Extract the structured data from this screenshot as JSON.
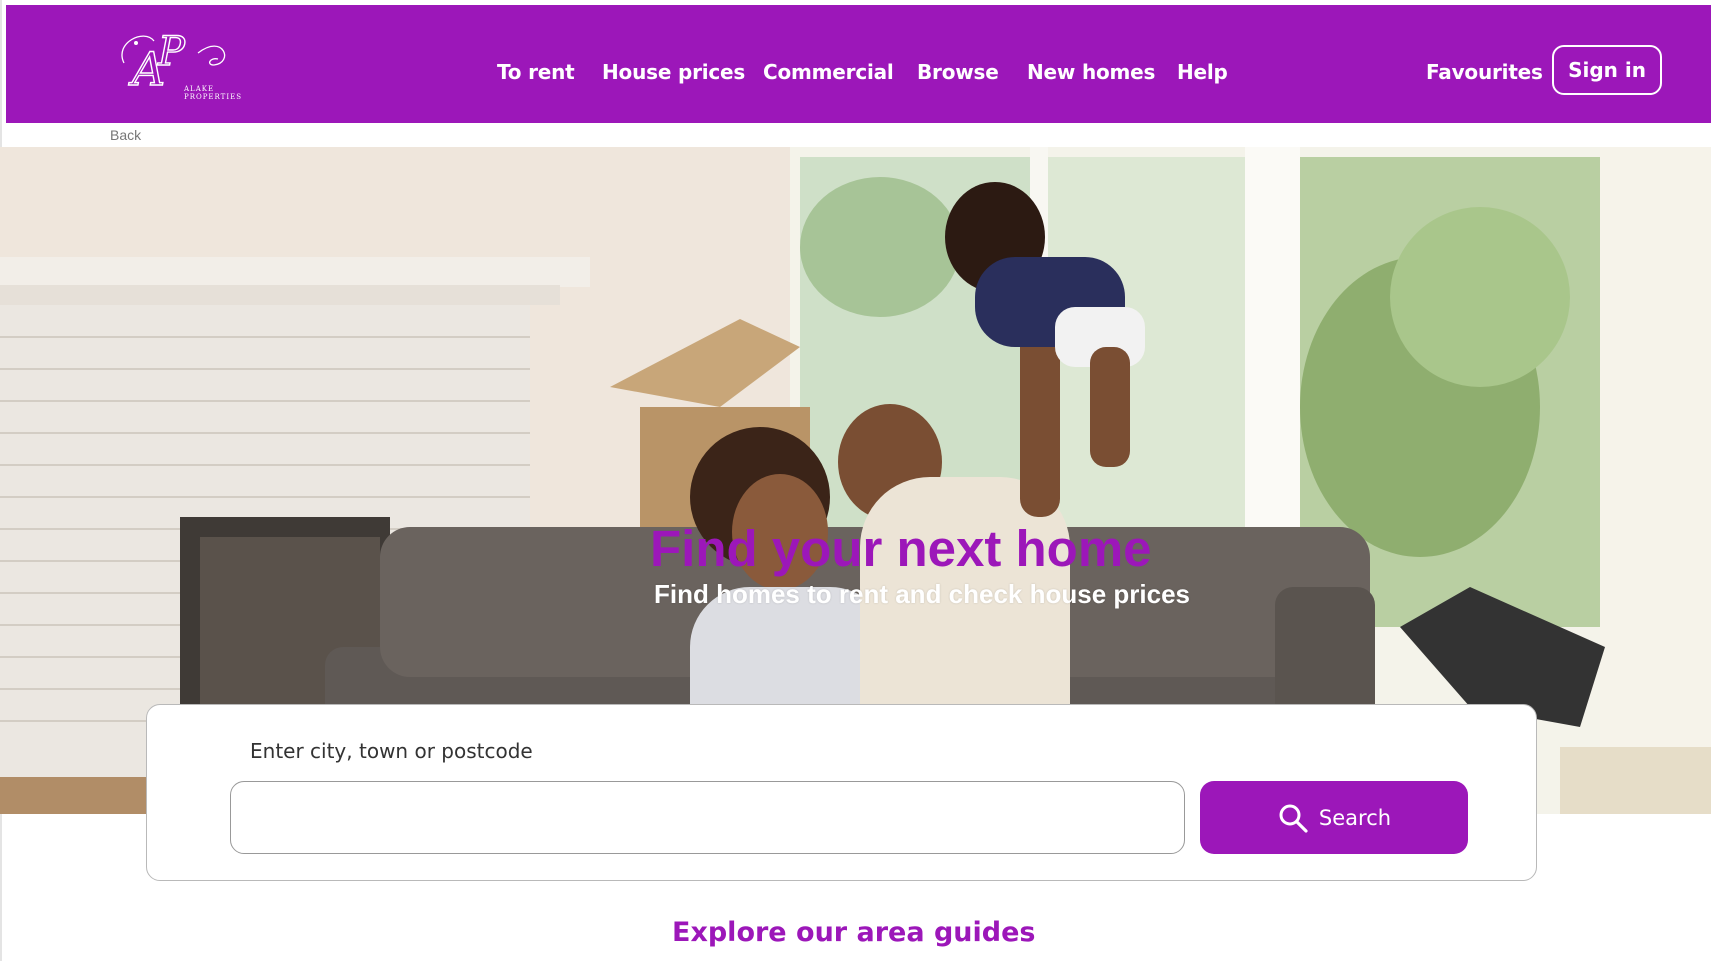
{
  "header": {
    "logo_text": "AP",
    "logo_tagline": "ALAKE PROPERTIES",
    "nav": [
      {
        "label": "To rent"
      },
      {
        "label": "House prices"
      },
      {
        "label": "Commercial"
      },
      {
        "label": "Browse"
      },
      {
        "label": "New homes"
      },
      {
        "label": "Help"
      }
    ],
    "favourites_label": "Favourites",
    "signin_label": "Sign in",
    "brand_color": "#9c17b9"
  },
  "back_label": "Back",
  "hero": {
    "title": "Find your next home",
    "subtitle": "Find homes to rent and check house prices"
  },
  "search": {
    "label": "Enter city, town or postcode",
    "value": "",
    "button_label": "Search",
    "button_icon": "search-icon"
  },
  "explore_title": "Explore our area guides"
}
